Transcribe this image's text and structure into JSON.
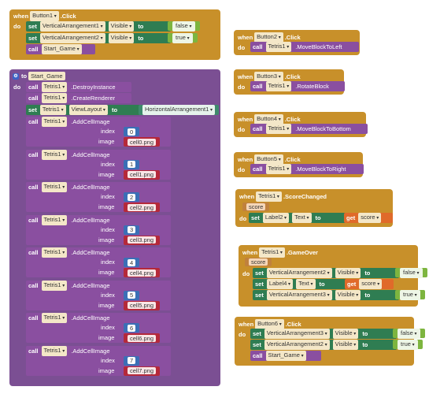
{
  "blocks": {
    "when": "when",
    "do": "do",
    "call": "call",
    "set": "set",
    "to": "to",
    "get": "get",
    "index": "index",
    "image": "image",
    "click": ".Click"
  },
  "b1": {
    "comp": "Button1",
    "setA_comp": "VerticalArrangement1",
    "setA_prop": "Visible",
    "setA_val": "false",
    "setB_comp": "VerticalArrangement2",
    "setB_prop": "Visible",
    "setB_val": "true",
    "call_proc": "Start_Game"
  },
  "proc": {
    "to": "to",
    "name": "Start_Game",
    "c1_comp": "Tetris1",
    "c1_method": ".DestroyInstance",
    "c2_comp": "Tetris1",
    "c2_method": ".CreateRenderer",
    "s_comp": "Tetris1",
    "s_prop": "ViewLayout",
    "s_val": "HorizontalArrangement1",
    "add_comp": "Tetris1",
    "add_method": ".AddCellImage",
    "cells": [
      {
        "index": "0",
        "image": "cell0.png"
      },
      {
        "index": "1",
        "image": "cell1.png"
      },
      {
        "index": "2",
        "image": "cell2.png"
      },
      {
        "index": "3",
        "image": "cell3.png"
      },
      {
        "index": "4",
        "image": "cell4.png"
      },
      {
        "index": "5",
        "image": "cell5.png"
      },
      {
        "index": "6",
        "image": "cell6.png"
      },
      {
        "index": "7",
        "image": "cell7.png"
      }
    ]
  },
  "b2": {
    "comp": "Button2",
    "target": "Tetris1",
    "method": ".MoveBlockToLeft"
  },
  "b3": {
    "comp": "Button3",
    "target": "Tetris1",
    "method": ".RotateBlock"
  },
  "b4": {
    "comp": "Button4",
    "target": "Tetris1",
    "method": ".MoveBlockToBottom"
  },
  "b5": {
    "comp": "Button5",
    "target": "Tetris1",
    "method": ".MoveBlockToRight"
  },
  "score": {
    "comp": "Tetris1",
    "event": ".ScoreChanged",
    "param": "score",
    "set_comp": "Label2",
    "set_prop": "Text",
    "get_var": "score"
  },
  "over": {
    "comp": "Tetris1",
    "event": ".GameOver",
    "param": "score",
    "a_comp": "VerticalArrangement2",
    "a_prop": "Visible",
    "a_val": "false",
    "b_comp": "Label4",
    "b_prop": "Text",
    "b_var": "score",
    "c_comp": "VerticalArrangement3",
    "c_prop": "Visible",
    "c_val": "true"
  },
  "b6": {
    "comp": "Button6",
    "a_comp": "VerticalArrangement3",
    "a_prop": "Visible",
    "a_val": "false",
    "b_comp": "VerticalArrangement2",
    "b_prop": "Visible",
    "b_val": "true",
    "call_proc": "Start_Game"
  },
  "colors": {
    "event": "#c8902a",
    "procedure": "#7b4f93",
    "call": "#8a4fa0",
    "setter": "#2f7d52",
    "logic": "#7db53f",
    "number": "#3b6fb6",
    "text": "#b5293a",
    "getter": "#e06a2a"
  }
}
